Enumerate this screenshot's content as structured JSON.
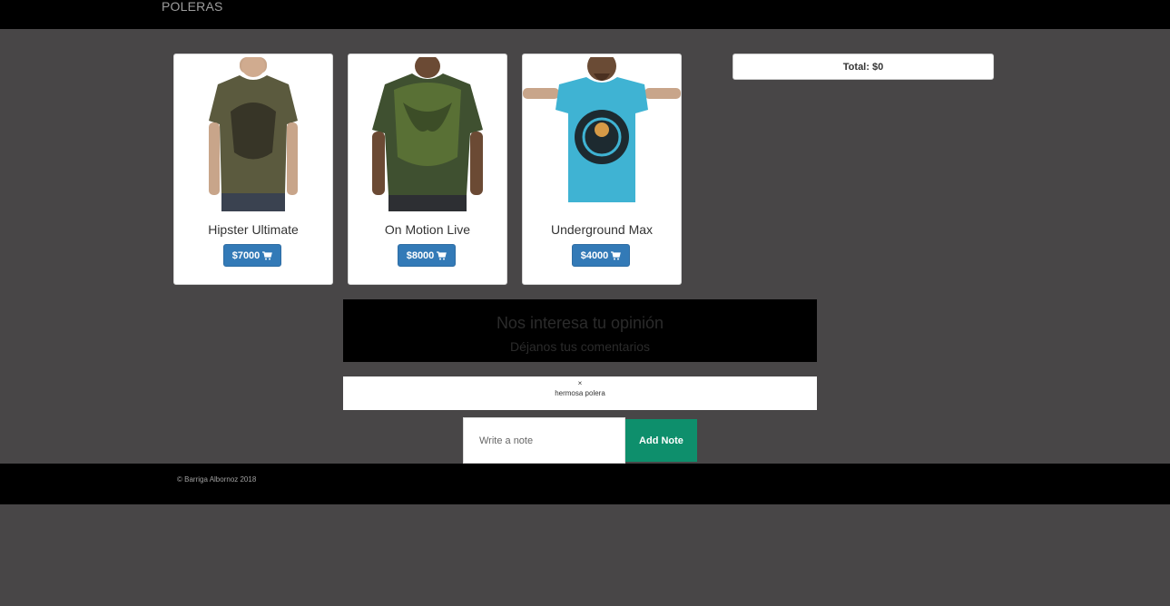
{
  "navbar": {
    "brand": "POLERAS"
  },
  "products": [
    {
      "name": "Hipster Ultimate",
      "price_label": "$7000",
      "shirt_color": "#5b5a3e",
      "print_color": "#2e2c22"
    },
    {
      "name": "On Motion Live",
      "price_label": "$8000",
      "shirt_color": "#3f5030",
      "print_color": "#6f8a3a"
    },
    {
      "name": "Underground Max",
      "price_label": "$4000",
      "shirt_color": "#3fb3d3",
      "print_color": "#1d2a30"
    }
  ],
  "cart": {
    "total_label": "Total: $0"
  },
  "feedback": {
    "title": "Nos interesa tu opinión",
    "subtitle": "Déjanos tus comentarios"
  },
  "notes": [
    {
      "close_glyph": "×",
      "text": "hermosa polera"
    }
  ],
  "note_form": {
    "placeholder": "Write a note",
    "button_label": "Add Note"
  },
  "footer": {
    "copyright": "© Barriga Albornoz 2018"
  },
  "colors": {
    "primary_button": "#337ab7",
    "add_note_button": "#0e8f6c",
    "background": "#484647"
  },
  "icons": {
    "cart": "shopping-cart-icon"
  }
}
